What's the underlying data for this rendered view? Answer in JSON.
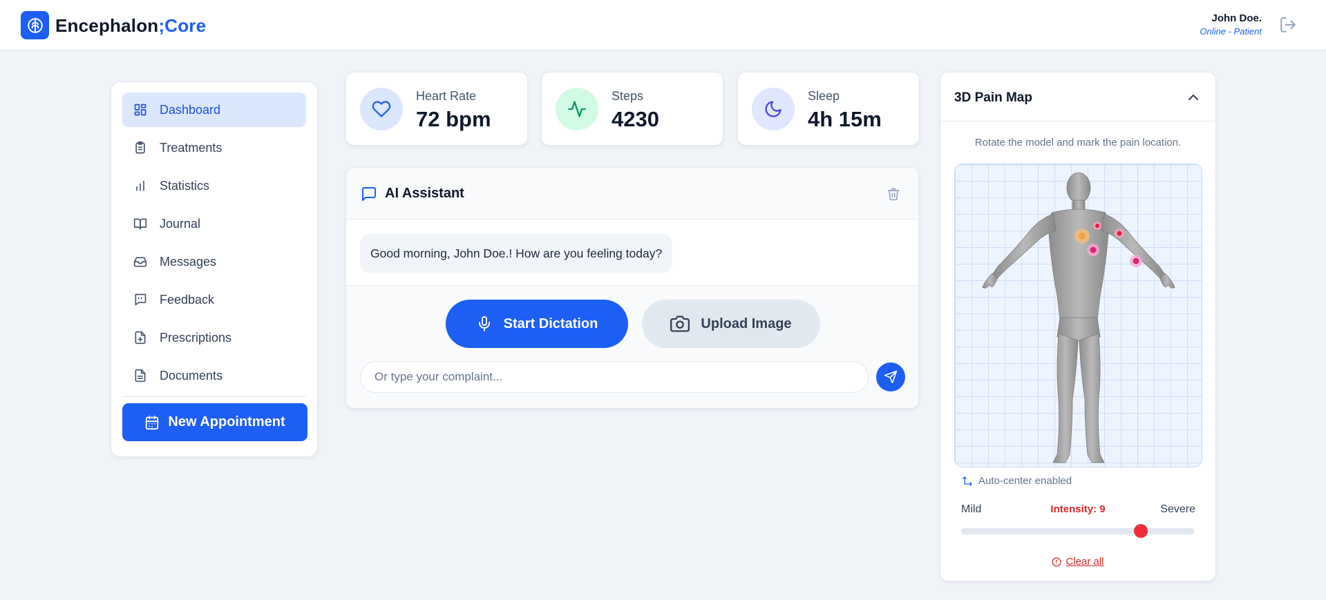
{
  "app": {
    "brand_main": "Encephalon",
    "brand_accent": ";Core",
    "icon": "brain-icon"
  },
  "user": {
    "name": "John Doe.",
    "status": "Online - Patient"
  },
  "sidebar": {
    "items": [
      {
        "label": "Dashboard",
        "icon": "dashboard-icon",
        "active": true
      },
      {
        "label": "Treatments",
        "icon": "clipboard-icon"
      },
      {
        "label": "Statistics",
        "icon": "bar-chart-icon"
      },
      {
        "label": "Journal",
        "icon": "book-icon"
      },
      {
        "label": "Messages",
        "icon": "inbox-icon"
      },
      {
        "label": "Feedback",
        "icon": "message-quote-icon"
      },
      {
        "label": "Prescriptions",
        "icon": "file-plus-icon"
      },
      {
        "label": "Documents",
        "icon": "file-text-icon"
      }
    ],
    "new_appointment": "New Appointment"
  },
  "stats": [
    {
      "label": "Heart Rate",
      "value": "72 bpm",
      "icon": "heart-icon",
      "color": "#2563eb",
      "bg": "#dbe7fd"
    },
    {
      "label": "Steps",
      "value": "4230",
      "icon": "activity-icon",
      "color": "#059669",
      "bg": "#d1fae5"
    },
    {
      "label": "Sleep",
      "value": "4h 15m",
      "icon": "moon-icon",
      "color": "#4f46e5",
      "bg": "#e0e7ff"
    }
  ],
  "assistant": {
    "title": "AI Assistant",
    "messages": [
      {
        "text": "Good morning, John Doe.! How are you feeling today?"
      }
    ],
    "dictation_label": "Start Dictation",
    "upload_label": "Upload Image",
    "input_placeholder": "Or type your complaint...",
    "input_value": ""
  },
  "pain_map": {
    "title": "3D Pain Map",
    "hint": "Rotate the model and mark the pain location.",
    "auto_center": "Auto-center enabled",
    "mild": "Mild",
    "severe": "Severe",
    "intensity_label": "Intensity: 9",
    "intensity_value": 9,
    "intensity_max": 10,
    "clear_label": "Clear all"
  },
  "colors": {
    "primary": "#1d5ef5",
    "danger": "#dc2626",
    "background": "#f0f3f8"
  }
}
